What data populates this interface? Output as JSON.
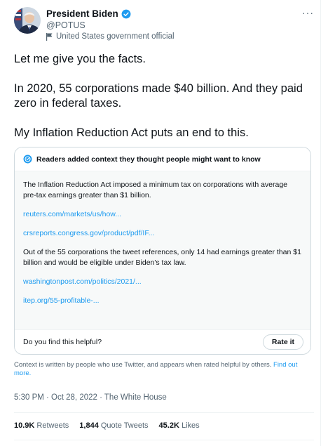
{
  "author": {
    "name": "President Biden",
    "handle": "@POTUS",
    "label": "United States government official"
  },
  "tweet": {
    "paragraphs": [
      "Let me give you the facts.",
      "In 2020, 55 corporations made $40 billion. And they paid zero in federal taxes.",
      "My Inflation Reduction Act puts an end to this."
    ]
  },
  "note": {
    "title": "Readers added context they thought people might want to know",
    "text1": "The Inflation Reduction Act imposed a minimum tax on corporations with average pre-tax earnings greater than $1 billion.",
    "link1": "reuters.com/markets/us/how...",
    "link2": "crsreports.congress.gov/product/pdf/IF...",
    "text2": "Out of the 55 corporations the tweet references, only 14 had earnings greater than $1 billion and would be eligible under Biden's tax law.",
    "link3": "washingtonpost.com/politics/2021/...",
    "link4": "itep.org/55-profitable-...",
    "helpful_prompt": "Do you find this helpful?",
    "rate_label": "Rate it"
  },
  "context": {
    "text": "Context is written by people who use Twitter, and appears when rated helpful by others.",
    "link": "Find out more."
  },
  "meta": {
    "timestamp": "5:30 PM · Oct 28, 2022 · The White House"
  },
  "stats": {
    "retweets_count": "10.9K",
    "retweets_label": "Retweets",
    "quotes_count": "1,844",
    "quotes_label": "Quote Tweets",
    "likes_count": "45.2K",
    "likes_label": "Likes"
  },
  "colors": {
    "accent": "#1d9bf0",
    "text": "#0f1419",
    "secondary": "#536471"
  }
}
